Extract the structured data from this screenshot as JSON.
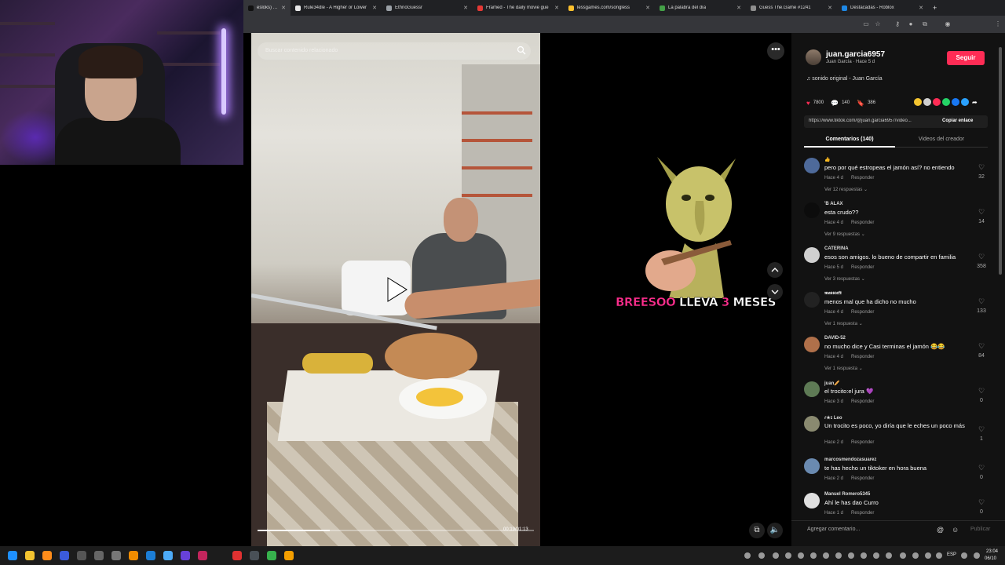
{
  "browser": {
    "tabs": [
      {
        "label": "esloks) | TikT",
        "active": true,
        "color": "#111111"
      },
      {
        "label": "Rule34dle - A Higher or Lower",
        "active": false,
        "color": "#e8e8e8"
      },
      {
        "label": "EthnoGuessr",
        "active": false,
        "color": "#9aa0a6"
      },
      {
        "label": "Framed - The daily movie gue",
        "active": false,
        "color": "#e53935"
      },
      {
        "label": "lessgames.com/songless",
        "active": false,
        "color": "#fbc02d"
      },
      {
        "label": "La palabra del día",
        "active": false,
        "color": "#43a047"
      },
      {
        "label": "Guess The.Game #1241",
        "active": false,
        "color": "#8e8e8e"
      },
      {
        "label": "Destacadas - Roblox",
        "active": false,
        "color": "#1e88e5"
      }
    ],
    "new_tab": "+"
  },
  "video": {
    "search_placeholder": "Buscar contenido relacionado",
    "timecode": "00:19/01:13",
    "progress": 0.26,
    "meme_caption_parts": [
      {
        "text": "BREESOO ",
        "pink": true
      },
      {
        "text": "LLEVA ",
        "pink": false
      },
      {
        "text": "3 ",
        "pink": true
      },
      {
        "text": "MESES",
        "pink": false
      }
    ]
  },
  "author": {
    "name": "juan.garcia6957",
    "sub": "Juan García · Hace 5 d",
    "follow_label": "Seguir"
  },
  "sound": "♫  sonido original - Juan García",
  "stats": {
    "likes": "7800",
    "comments": "140",
    "saves": "386"
  },
  "share_colors": [
    "#f4c430",
    "#cfcfcf",
    "#fe2c55",
    "#25d366",
    "#1877f2",
    "#2aa1ff"
  ],
  "link": {
    "url": "https://www.tiktok.com/@juan.garcia6957/video...",
    "copy_label": "Copiar enlace"
  },
  "tabs": {
    "comments": "Comentarios (140)",
    "videos": "Videos del creador"
  },
  "comments": [
    {
      "user": "👍",
      "text": "pero por qué estropeas el jamón así? no entiendo",
      "age": "Hace 4 d",
      "reply": "Responder",
      "replies": "Ver 12 respuestas ⌄",
      "likes": "32",
      "avatar": "#4e6a9a"
    },
    {
      "user": "'B ALAX",
      "text": "esta crudo??",
      "age": "Hace 4 d",
      "reply": "Responder",
      "replies": "Ver 9 respuestas ⌄",
      "likes": "14",
      "avatar": "#0c0c0c"
    },
    {
      "user": "CATERINA",
      "text": "esos son amigos. lo bueno de compartir en familia",
      "age": "Hace 5 d",
      "reply": "Responder",
      "replies": "Ver 3 respuestas ⌄",
      "likes": "358",
      "avatar": "#d0d0d0"
    },
    {
      "user": "𝖒𝖆𝖘𝖘𝖈𝖔𝖋𝖙",
      "text": "menos mal que ha dicho no mucho",
      "age": "Hace 4 d",
      "reply": "Responder",
      "replies": "Ver 1 respuesta ⌄",
      "likes": "133",
      "avatar": "#222222"
    },
    {
      "user": "DAVID-52",
      "text": "no mucho dice y Casi terminas el jamón 😂😂",
      "age": "Hace 4 d",
      "reply": "Responder",
      "replies": "Ver 1 respuesta ⌄",
      "likes": "84",
      "avatar": "#b0704a"
    },
    {
      "user": "juan🥖",
      "text": "el trocito:el jura 💜",
      "age": "Hace 3 d",
      "reply": "Responder",
      "replies": "",
      "likes": "0",
      "avatar": "#5e7a55"
    },
    {
      "user": "ɾ★ɪ Leo",
      "text": "Un trocito es poco, yo diría que le eches un poco más",
      "age": "Hace 2 d",
      "reply": "Responder",
      "replies": "",
      "likes": "1",
      "avatar": "#8a8a70"
    },
    {
      "user": "marcosmendozasuarez",
      "text": "te has hecho un tiktoker en hora buena",
      "age": "Hace 2 d",
      "reply": "Responder",
      "replies": "",
      "likes": "0",
      "avatar": "#6a8ab0"
    },
    {
      "user": "Manuel Romero5345",
      "text": "Ahí le has dao Curro",
      "age": "Hace 1 d",
      "reply": "Responder",
      "replies": "",
      "likes": "0",
      "avatar": "#e0e0e0"
    }
  ],
  "comment_box": {
    "placeholder": "Agregar comentario...",
    "publish": "Publicar"
  },
  "taskbar": {
    "lang": "ESP",
    "time": "23:04",
    "date": "06/10"
  }
}
